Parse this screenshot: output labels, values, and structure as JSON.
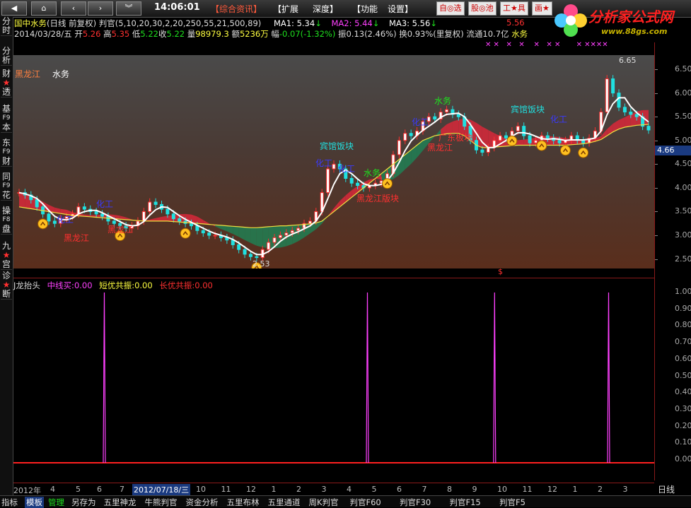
{
  "toolbar": {
    "clock": "14:06:01",
    "menu_info": "【综合资讯】",
    "menu_expand": "【扩展",
    "menu_depth": "深度】",
    "menu_func": "【功能",
    "menu_settings": "设置】",
    "btn_zixuan": "自◎选",
    "btn_guchi": "股◎池",
    "btn_tool": "工★具",
    "btn_hua": "画★",
    "logo_text": "分析家公式网",
    "logo_url": "www.88gs.com"
  },
  "left_tabs": [
    {
      "t1": "分",
      "t2": "时"
    },
    {
      "t1": "分",
      "t2": "析"
    },
    {
      "t1": "财",
      "s": "★",
      "t2": "透"
    },
    {
      "t1": "基",
      "t2": "F9",
      "t3": "本"
    },
    {
      "t1": "东",
      "t2": "F9",
      "t3": "财"
    },
    {
      "t1": "同",
      "t2": "F9",
      "t3": "花"
    },
    {
      "t1": "操",
      "t2": "F8",
      "t3": "盘"
    },
    {
      "t1": "九",
      "s": "★",
      "t2": "宫"
    },
    {
      "t1": "诊",
      "s": "★",
      "t2": "断"
    }
  ],
  "header": {
    "stock": "国中水务",
    "params": "(日线 前复权) 判官(5,10,20,30,2,20,250,55,21,500,89)",
    "ma1": "MA1: 5.34",
    "ma2": "MA2: 5.44",
    "ma3": "MA3: 5.56",
    "right_value": "5.56",
    "date": "2014/03/28/五",
    "open_label": "开",
    "open": "5.26",
    "high_label": "高",
    "high": "5.35",
    "low_label": "低",
    "low": "5.22",
    "close_label": "收",
    "close": "5.22",
    "vol_label": "量",
    "vol": "98979.3",
    "amt_label": "额",
    "amt": "5236万",
    "chg_label": "幅",
    "chg": "-0.07(-1.32%)",
    "amp": "振0.13(2.46%)",
    "turn": "换0.93%(里复权)",
    "float": "流通10.7亿",
    "industry": "水务"
  },
  "chart_labels": {
    "tag_region": "黑龙江",
    "tag_industry": "水务",
    "high_mark": "6.65",
    "low_mark": "2.53",
    "current_price": "4.66",
    "dollar": "$"
  },
  "annotations": [
    {
      "text": "化工",
      "color": "#3a3aff"
    },
    {
      "text": "化工",
      "color": "#3a3aff"
    },
    {
      "text": "黑龙江",
      "color": "#ff3030"
    },
    {
      "text": "黑龙江",
      "color": "#ff3030"
    },
    {
      "text": "宾馆饭块",
      "color": "#20e0e0"
    },
    {
      "text": "化工",
      "color": "#3a3aff"
    },
    {
      "text": "化工",
      "color": "#3a3aff"
    },
    {
      "text": "水务",
      "color": "#1ee01e"
    },
    {
      "text": "黑龙江版块",
      "color": "#ff3030"
    },
    {
      "text": "水务",
      "color": "#1ee01e"
    },
    {
      "text": "化工",
      "color": "#3a3aff"
    },
    {
      "text": "黑龙江",
      "color": "#ff3030"
    },
    {
      "text": "广东板块",
      "color": "#ff3030"
    },
    {
      "text": "宾馆饭块",
      "color": "#20e0e0"
    },
    {
      "text": "化工",
      "color": "#3a3aff"
    }
  ],
  "sub_header": {
    "name": "J龙抬头",
    "mid_label": "中线买:",
    "mid_val": "0.00",
    "short_label": "短优共振:",
    "short_val": "0.00",
    "long_label": "长优共振:",
    "long_val": "0.00"
  },
  "price_axis": [
    "6.50",
    "6.00",
    "5.50",
    "5.00",
    "4.50",
    "4.00",
    "3.50",
    "3.00",
    "2.50"
  ],
  "indicator_axis": [
    "1.00",
    "0.90",
    "0.80",
    "0.70",
    "0.60",
    "0.50",
    "0.40",
    "0.30",
    "0.20",
    "0.10",
    "0.00"
  ],
  "date_axis": {
    "year": "2012年",
    "months": [
      "4",
      "5",
      "6",
      "7"
    ],
    "highlight": "2012/07/18/三",
    "months2": [
      "10",
      "11",
      "12",
      "1",
      "2",
      "3",
      "4",
      "5",
      "6",
      "7",
      "8",
      "9",
      "10",
      "11",
      "12",
      "1",
      "2",
      "3"
    ]
  },
  "period": "日线",
  "bottom_tabs": [
    "指标",
    "模板",
    "管理",
    "另存为",
    "五里神龙",
    "牛熊判官",
    "资金分析",
    "五里布林",
    "五里通道",
    "周K判官",
    "判官F60",
    "判官F30",
    "判官F15",
    "判官F5"
  ],
  "colors": {
    "up": "#ff3030",
    "down": "#20e0e0",
    "ma_white": "#ffffff",
    "ma_yellow": "#f0e040",
    "signal": "#ff40ff",
    "green_band": "#1a8a5a",
    "red_band": "#d8283a"
  },
  "chart_data": {
    "type": "line",
    "price_range": [
      2.3,
      6.8
    ],
    "close": [
      3.9,
      3.85,
      3.75,
      3.6,
      3.45,
      3.3,
      3.25,
      3.35,
      3.4,
      3.45,
      3.6,
      3.55,
      3.5,
      3.45,
      3.4,
      3.3,
      3.25,
      3.2,
      3.15,
      3.2,
      3.3,
      3.5,
      3.7,
      3.65,
      3.55,
      3.45,
      3.35,
      3.3,
      3.25,
      3.2,
      3.1,
      3.05,
      3.0,
      3.0,
      2.95,
      2.9,
      2.8,
      2.7,
      2.6,
      2.55,
      2.53,
      2.7,
      2.85,
      2.95,
      3.0,
      3.05,
      3.1,
      3.15,
      3.25,
      3.3,
      3.5,
      3.9,
      4.4,
      4.5,
      4.4,
      4.2,
      4.1,
      4.05,
      4.0,
      4.05,
      4.1,
      4.15,
      4.3,
      4.7,
      5.0,
      5.15,
      5.1,
      5.2,
      5.4,
      5.5,
      5.45,
      5.6,
      5.65,
      5.55,
      5.5,
      5.3,
      5.0,
      4.8,
      4.75,
      4.85,
      5.0,
      5.1,
      5.05,
      5.2,
      5.3,
      5.1,
      4.95,
      5.0,
      5.1,
      5.05,
      5.0,
      4.95,
      5.0,
      5.1,
      5.0,
      4.95,
      5.05,
      5.2,
      5.6,
      6.3,
      6.0,
      5.7,
      5.6,
      5.55,
      5.5,
      5.3,
      5.22
    ],
    "ma_slow": [
      3.6,
      3.58,
      3.56,
      3.54,
      3.52,
      3.5,
      3.48,
      3.46,
      3.44,
      3.42,
      3.41,
      3.4,
      3.39,
      3.38,
      3.37,
      3.36,
      3.35,
      3.34,
      3.33,
      3.32,
      3.31,
      3.3,
      3.3,
      3.3,
      3.3,
      3.3,
      3.29,
      3.28,
      3.27,
      3.26,
      3.25,
      3.24,
      3.23,
      3.22,
      3.21,
      3.2,
      3.19,
      3.18,
      3.17,
      3.16,
      3.16,
      3.17,
      3.18,
      3.19,
      3.2,
      3.2,
      3.21,
      3.22,
      3.23,
      3.24,
      3.26,
      3.3,
      3.4,
      3.5,
      3.6,
      3.7,
      3.8,
      3.9,
      4.0,
      4.1,
      4.2,
      4.3,
      4.4,
      4.5,
      4.6,
      4.7,
      4.8,
      4.9,
      5.0,
      5.05,
      5.1,
      5.12,
      5.14,
      5.15,
      5.15,
      5.1,
      5.0,
      4.9,
      4.85,
      4.85,
      4.86,
      4.87,
      4.88,
      4.89,
      4.9,
      4.9,
      4.9,
      4.9,
      4.9,
      4.9,
      4.9,
      4.9,
      4.9,
      4.91,
      4.92,
      4.93,
      4.95,
      4.98,
      5.02,
      5.1,
      5.18,
      5.24,
      5.28,
      5.3,
      5.32,
      5.33,
      5.34
    ],
    "signals_x": [
      35,
      155,
      213,
      265
    ]
  }
}
